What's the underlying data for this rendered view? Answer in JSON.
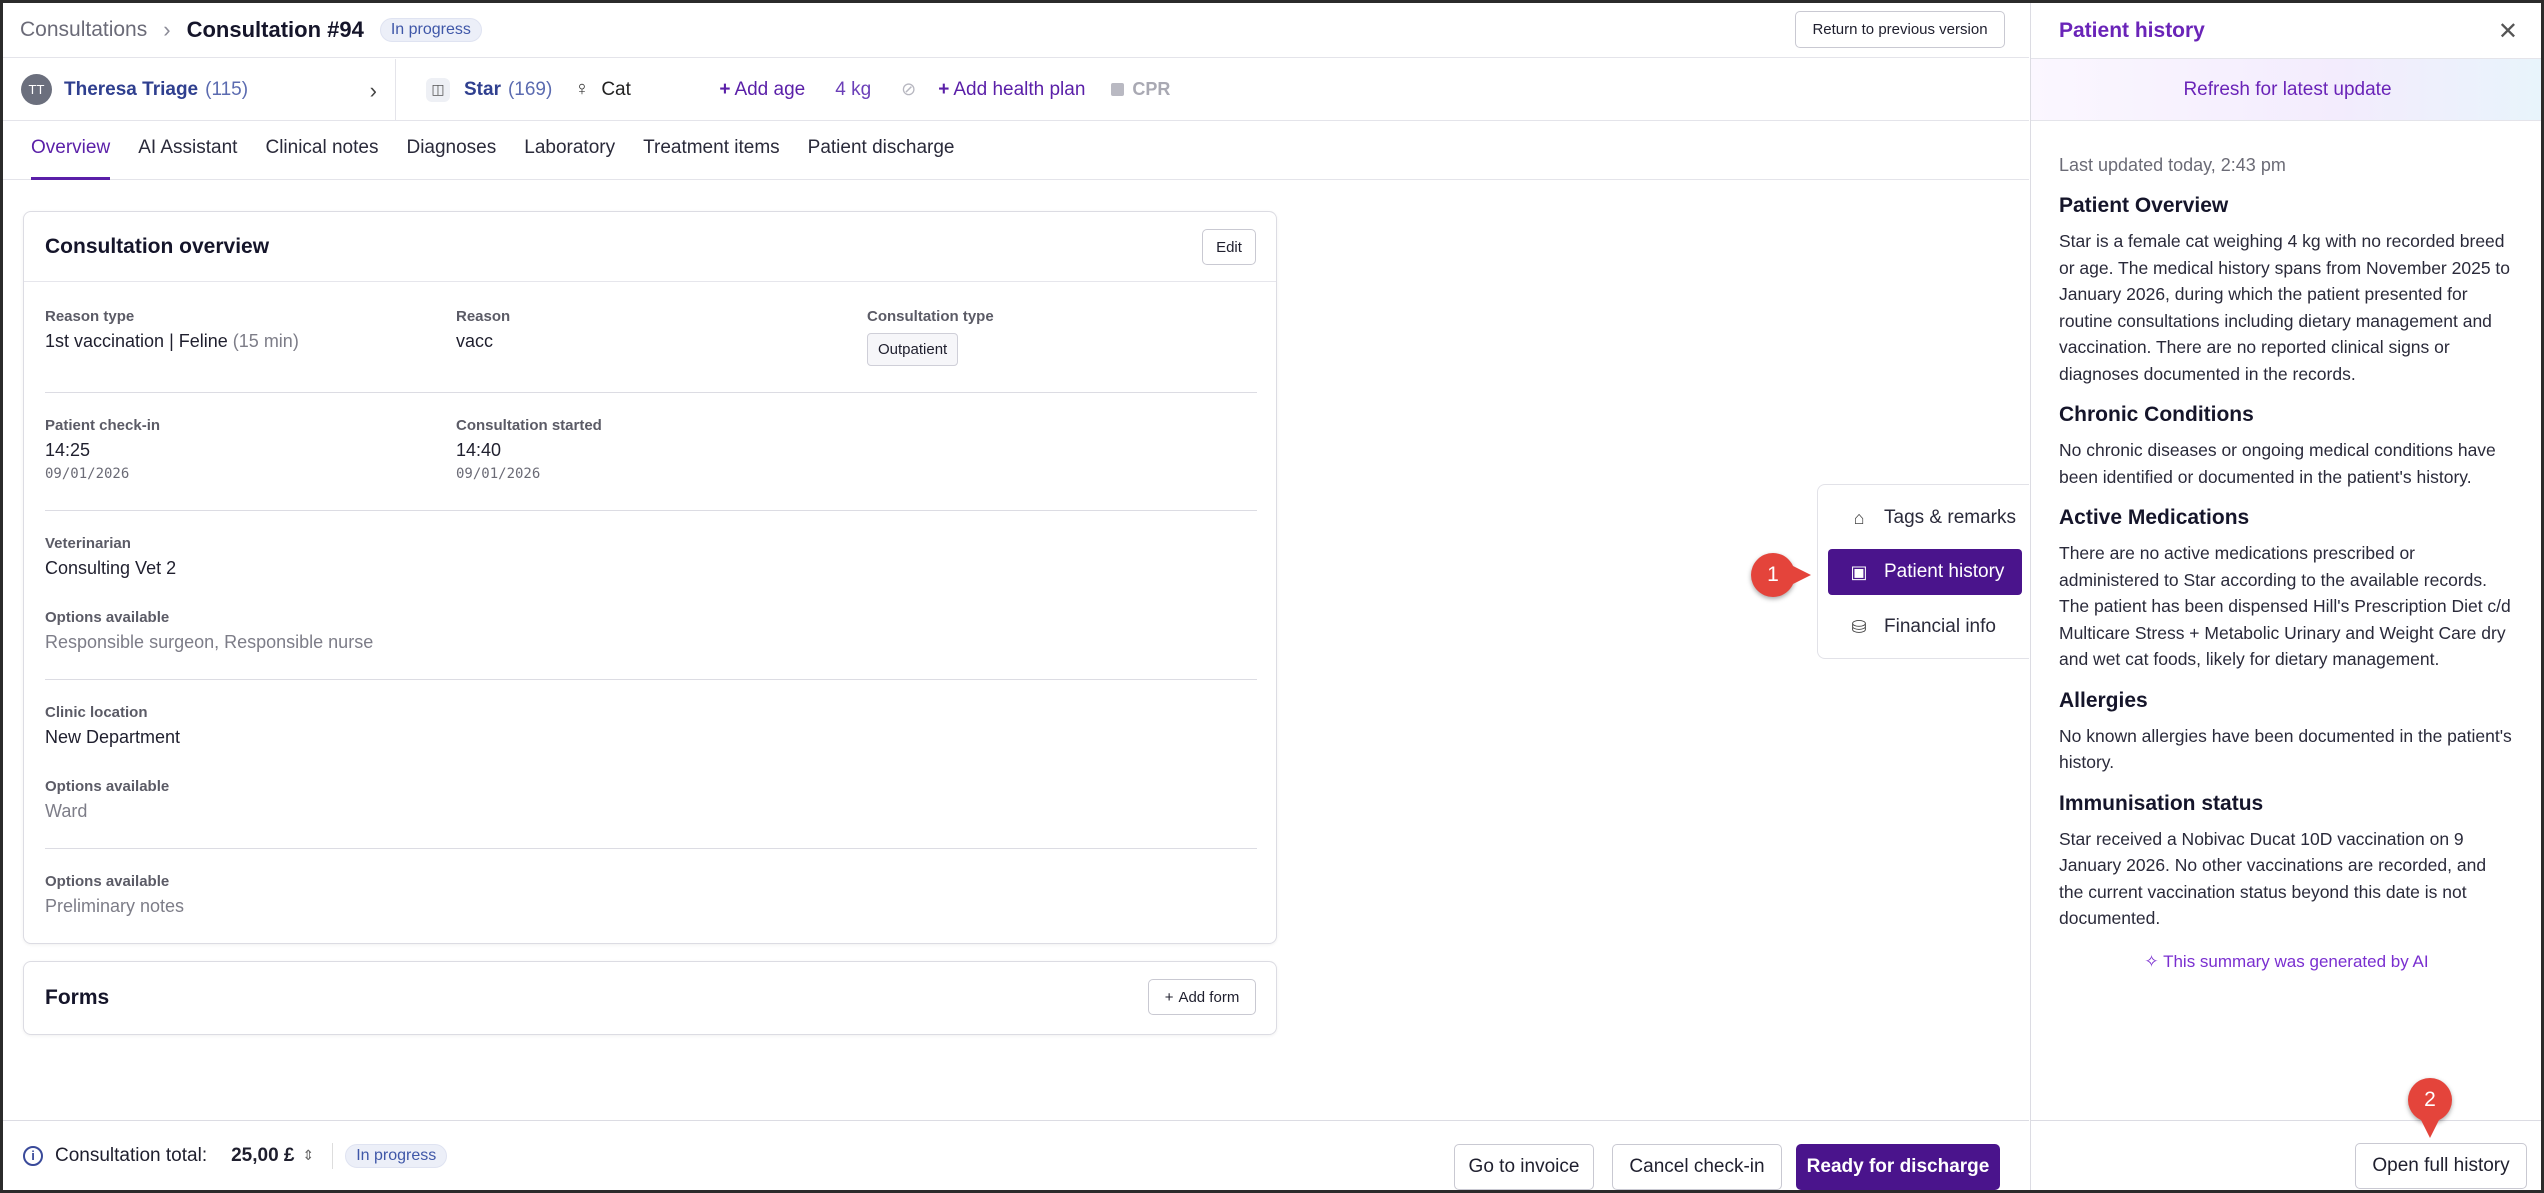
{
  "breadcrumb": {
    "parent": "Consultations",
    "separator": "›",
    "title": "Consultation #94",
    "status": "In progress"
  },
  "header": {
    "return_button": "Return to previous version"
  },
  "client": {
    "initials": "TT",
    "name": "Theresa Triage",
    "id": "(115)"
  },
  "patient": {
    "name": "Star",
    "id": "(169)",
    "sex_symbol": "♀",
    "species": "Cat",
    "add_age": "Add age",
    "weight": "4 kg",
    "add_health_plan": "Add health plan",
    "cpr": "CPR"
  },
  "tabs": [
    "Overview",
    "AI Assistant",
    "Clinical notes",
    "Diagnoses",
    "Laboratory",
    "Treatment items",
    "Patient discharge"
  ],
  "overview": {
    "title": "Consultation overview",
    "edit_button": "Edit",
    "reason_type_label": "Reason type",
    "reason_type_value": "1st vaccination | Feline",
    "reason_type_duration": "(15 min)",
    "reason_label": "Reason",
    "reason_value": "vacc",
    "consultation_type_label": "Consultation type",
    "consultation_type_value": "Outpatient",
    "checkin_label": "Patient check-in",
    "checkin_time": "14:25",
    "checkin_date": "09/01/2026",
    "started_label": "Consultation started",
    "started_time": "14:40",
    "started_date": "09/01/2026",
    "vet_label": "Veterinarian",
    "vet_value": "Consulting Vet 2",
    "vet_options_label": "Options available",
    "vet_options_value": "Responsible surgeon, Responsible nurse",
    "clinic_label": "Clinic location",
    "clinic_value": "New Department",
    "clinic_options_label": "Options available",
    "clinic_options_value": "Ward",
    "notes_options_label": "Options available",
    "notes_options_value": "Preliminary notes"
  },
  "forms": {
    "title": "Forms",
    "add_button": "Add form"
  },
  "side_menu": [
    {
      "label": "Tags & remarks",
      "icon": "tag-icon"
    },
    {
      "label": "Patient history",
      "icon": "history-icon"
    },
    {
      "label": "Financial info",
      "icon": "coins-icon"
    }
  ],
  "markers": {
    "one": "1",
    "two": "2"
  },
  "footer": {
    "total_label": "Consultation total:",
    "total_value": "25,00 £",
    "status": "In progress",
    "go_to_invoice": "Go to invoice",
    "cancel_checkin": "Cancel check-in",
    "ready_for_discharge": "Ready for discharge"
  },
  "history": {
    "title": "Patient history",
    "refresh": "Refresh for latest update",
    "last_updated": "Last updated today, 2:43 pm",
    "sections": [
      {
        "heading": "Patient Overview",
        "text": "Star is a female cat weighing 4 kg with no recorded breed or age. The medical history spans from November 2025 to January 2026, during which the patient presented for routine consultations including dietary management and vaccination. There are no reported clinical signs or diagnoses documented in the records."
      },
      {
        "heading": "Chronic Conditions",
        "text": "No chronic diseases or ongoing medical conditions have been identified or documented in the patient's history."
      },
      {
        "heading": "Active Medications",
        "text": "There are no active medications prescribed or administered to Star according to the available records. The patient has been dispensed Hill's Prescription Diet c/d Multicare Stress + Metabolic Urinary and Weight Care dry and wet cat foods, likely for dietary management."
      },
      {
        "heading": "Allergies",
        "text": "No known allergies have been documented in the patient's history."
      },
      {
        "heading": "Immunisation status",
        "text": "Star received a Nobivac Ducat 10D vaccination on 9 January 2026. No other vaccinations are recorded, and the current vaccination status beyond this date is not documented."
      }
    ],
    "ai_note": "This summary was generated by AI",
    "open_full": "Open full history"
  },
  "colors": {
    "brand": "#4a148c",
    "accent_purple": "#6a24b8",
    "link_blue": "#2f3f8f",
    "marker_red": "#e4443b"
  }
}
